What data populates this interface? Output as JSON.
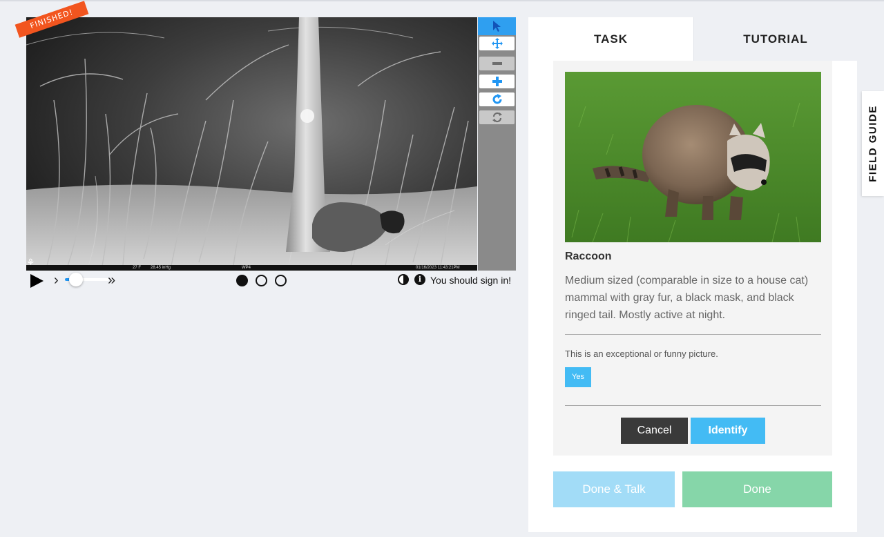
{
  "viewer": {
    "finished_label": "FINISHED!",
    "info_strip": {
      "temperature": "27 F",
      "pressure": "28.45 inHg",
      "camera_id": "WP4",
      "timestamp": "01/16/2023 11:43:21PM"
    },
    "tools": [
      {
        "name": "pointer",
        "icon": "pointer-icon",
        "state": "active"
      },
      {
        "name": "move",
        "icon": "move-icon",
        "state": "enabled"
      },
      {
        "name": "zoom-out",
        "icon": "minus-icon",
        "state": "disabled"
      },
      {
        "name": "zoom-in",
        "icon": "plus-icon",
        "state": "enabled"
      },
      {
        "name": "rotate",
        "icon": "rotate-icon",
        "state": "enabled"
      },
      {
        "name": "reset",
        "icon": "reset-icon",
        "state": "disabled"
      }
    ],
    "controls": {
      "slow_glyph": "›",
      "fast_glyph": "»",
      "speed_fraction": 0.25,
      "frames": [
        true,
        false,
        false
      ],
      "signin_text": "You should sign in!"
    }
  },
  "panel": {
    "tabs": [
      {
        "label": "TASK",
        "active": true
      },
      {
        "label": "TUTORIAL",
        "active": false
      }
    ],
    "choice": {
      "name": "Raccoon",
      "description": "Medium sized (comparable in size to a house cat) mammal with gray fur, a black mask, and black ringed tail. Mostly active at night."
    },
    "question": "This is an exceptional or funny picture.",
    "answers": {
      "yes": "Yes"
    },
    "buttons": {
      "cancel": "Cancel",
      "identify": "Identify",
      "done_talk": "Done & Talk",
      "done": "Done"
    }
  },
  "field_guide": {
    "label": "FIELD GUIDE"
  },
  "colors": {
    "accent_blue": "#43bbf4",
    "done_green": "#86d6a9",
    "finished_orange": "#f2551f",
    "background": "#eef0f4"
  }
}
